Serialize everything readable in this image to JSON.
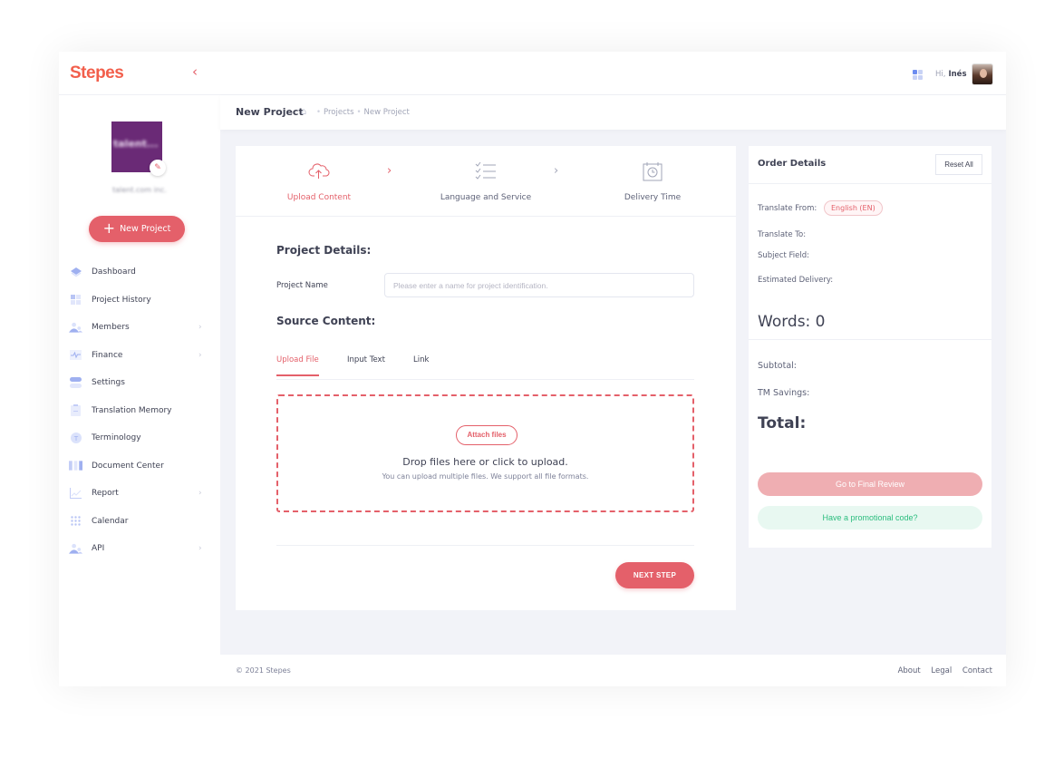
{
  "app": {
    "brand": "Stepes",
    "company_name": "talent.com inc.",
    "logo_text": "talent...",
    "colors": {
      "accent": "#e4606a",
      "brand": "#f25f4c",
      "success": "#2bbd7e",
      "sidebar_icon": "#c8d2f5"
    }
  },
  "sidebar": {
    "collapse_icon": "chevron-left-icon",
    "new_project_label": "New Project",
    "items": [
      {
        "label": "Dashboard",
        "icon": "layers-icon",
        "has_submenu": false
      },
      {
        "label": "Project History",
        "icon": "grid-icon",
        "has_submenu": false
      },
      {
        "label": "Members",
        "icon": "users-icon",
        "has_submenu": true
      },
      {
        "label": "Finance",
        "icon": "pulse-icon",
        "has_submenu": true
      },
      {
        "label": "Settings",
        "icon": "toggle-icon",
        "has_submenu": false
      },
      {
        "label": "Translation Memory",
        "icon": "clipboard-icon",
        "has_submenu": false
      },
      {
        "label": "Terminology",
        "icon": "terminology-icon",
        "has_submenu": false
      },
      {
        "label": "Document Center",
        "icon": "columns-icon",
        "has_submenu": false
      },
      {
        "label": "Report",
        "icon": "chart-line-icon",
        "has_submenu": true
      },
      {
        "label": "Calendar",
        "icon": "dots-grid-icon",
        "has_submenu": false
      },
      {
        "label": "API",
        "icon": "users-icon",
        "has_submenu": true
      }
    ]
  },
  "topbar": {
    "greeting": "Hi,",
    "user_name": "Inés"
  },
  "subheader": {
    "title": "New Project",
    "breadcrumb": [
      "Projects",
      "New Project"
    ]
  },
  "steps": [
    {
      "label": "Upload Content",
      "icon": "cloud-upload-icon",
      "active": true
    },
    {
      "label": "Language and Service",
      "icon": "checklist-icon",
      "active": false
    },
    {
      "label": "Delivery Time",
      "icon": "calendar-clock-icon",
      "active": false
    }
  ],
  "form": {
    "project_details_title": "Project Details:",
    "project_name_label": "Project Name",
    "project_name_value": "",
    "project_name_placeholder": "Please enter a name for project identification.",
    "source_content_title": "Source Content:",
    "tabs": [
      {
        "label": "Upload File",
        "active": true
      },
      {
        "label": "Input Text",
        "active": false
      },
      {
        "label": "Link",
        "active": false
      }
    ],
    "attach_label": "Attach files",
    "drop_main": "Drop files here or click to upload.",
    "drop_sub": "You can upload multiple files. We support all file formats.",
    "next_label": "NEXT STEP"
  },
  "order": {
    "title": "Order Details",
    "reset_label": "Reset All",
    "translate_from_label": "Translate From:",
    "translate_from_value": "English (EN)",
    "translate_to_label": "Translate To:",
    "subject_field_label": "Subject Field:",
    "estimated_delivery_label": "Estimated Delivery:",
    "words_label": "Words: 0",
    "subtotal_label": "Subtotal:",
    "tm_savings_label": "TM Savings:",
    "total_label": "Total:",
    "final_review_label": "Go to Final Review",
    "promo_label": "Have a promotional code?"
  },
  "footer": {
    "copyright": "© 2021 Stepes",
    "links": [
      "About",
      "Legal",
      "Contact"
    ]
  }
}
